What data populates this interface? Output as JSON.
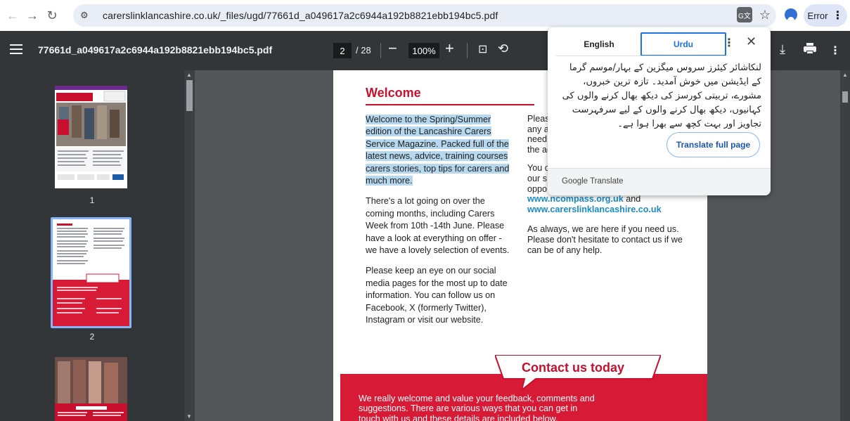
{
  "browser": {
    "url": "carerslinklancashire.co.uk/_files/ugd/77661d_a049617a2c6944a192b8821ebb194bc5.pdf",
    "error_label": "Error",
    "icons": [
      "back-arrow-icon",
      "forward-arrow-icon",
      "reload-icon",
      "tune-icon",
      "translate-icon",
      "star-icon",
      "profile-icon",
      "kebab-icon"
    ]
  },
  "pdf_toolbar": {
    "filename": "77661d_a049617a2c6944a192b8821ebb194bc5.pdf",
    "current_page": "2",
    "total_pages": "/ 28",
    "zoom": "100%"
  },
  "sidebar": {
    "pages": [
      "1",
      "2"
    ]
  },
  "page": {
    "heading": "Welcome",
    "left_col": {
      "highlight_text": "Welcome to the Spring/Summer edition of the Lancashire Carers Service Magazine. Packed full of the latest news, advice, training courses carers stories, top tips for carers and much more.",
      "para2": "There's a lot going on over the coming months, including Carers Week from 10th -14th June. Please have a look at everything on offer - we have a lovely selection of events.",
      "para3": "Please keep an eye on our social media pages for the most up to date information. You can follow us on Facebook, X (formerly Twitter), Instagram or visit our website."
    },
    "right_col": {
      "lines_a": [
        "Pleas",
        "any a",
        "need",
        "the ac"
      ],
      "lines_b": [
        "You c",
        "our s",
        "oppo"
      ],
      "link1": "www.ncompass.org.uk",
      "link_and": " and",
      "link2": "www.carerslinklancashire.co.uk",
      "closing": "As always, we are here if you need us. Please don't hesitate to contact us if we can be of any help."
    },
    "contact": {
      "banner": "Contact us today",
      "text": "We really welcome and value your feedback, comments and suggestions. There are various ways that you can get in touch with us and these details are included below."
    }
  },
  "translate_popup": {
    "tab_english": "English",
    "tab_urdu": "Urdu",
    "urdu_text": "لنکاشائر کیئرز سروس میگزین کے بہار/موسم گرما کے ایڈیشن میں خوش آمدید۔ تازہ ترین خبروں، مشورے، تربیتی کورسز کی دیکھ بھال کرنے والوں کی کہانیوں، دیکھ بھال کرنے والوں کے لیے سرفہرست تجاویز اور بہت کچھ سے بھرا ہوا ہے۔",
    "translate_button": "Translate full page",
    "footer": "Google Translate"
  },
  "colors": {
    "accent_red": "#c8102e",
    "link_blue": "#1a8cc7",
    "toolbar_dark": "#323639",
    "highlight": "#b5d8ee"
  }
}
